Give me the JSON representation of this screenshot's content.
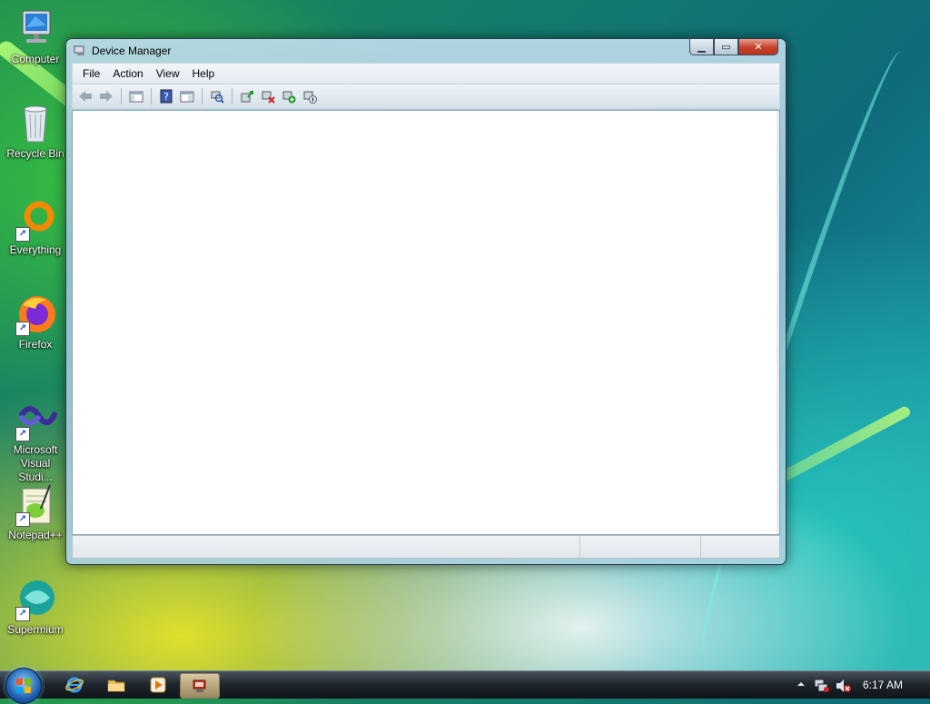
{
  "desktop": {
    "icons": [
      {
        "label": "Computer",
        "icon": "computer-icon"
      },
      {
        "label": "Recycle Bin",
        "icon": "recycle-bin-icon"
      },
      {
        "label": "Everything",
        "icon": "everything-icon"
      },
      {
        "label": "Firefox",
        "icon": "firefox-icon"
      },
      {
        "label": "Microsoft Visual Studi...",
        "icon": "visual-studio-icon"
      },
      {
        "label": "Notepad++",
        "icon": "notepadpp-icon"
      },
      {
        "label": "Supermium",
        "icon": "supermium-icon"
      }
    ]
  },
  "window": {
    "title": "Device Manager",
    "menu": [
      "File",
      "Action",
      "View",
      "Help"
    ],
    "toolbar": [
      "back-icon",
      "forward-icon",
      "show-hide-console-tree-icon",
      "help-icon",
      "properties-icon",
      "scan-hardware-icon",
      "update-driver-icon",
      "uninstall-device-icon",
      "enable-device-icon",
      "disable-device-icon"
    ]
  },
  "taskbar": {
    "quick_launch": [
      "internet-explorer-icon",
      "windows-explorer-icon",
      "media-player-icon"
    ],
    "active_task": "device-manager-icon",
    "tray": [
      "show-hidden-icons-icon",
      "network-icon",
      "volume-muted-icon"
    ],
    "clock": "6:17 AM"
  },
  "colors": {
    "close_button": "#c6402a",
    "taskbar": "#1f262d",
    "desktop_accent": "#137a6e"
  }
}
